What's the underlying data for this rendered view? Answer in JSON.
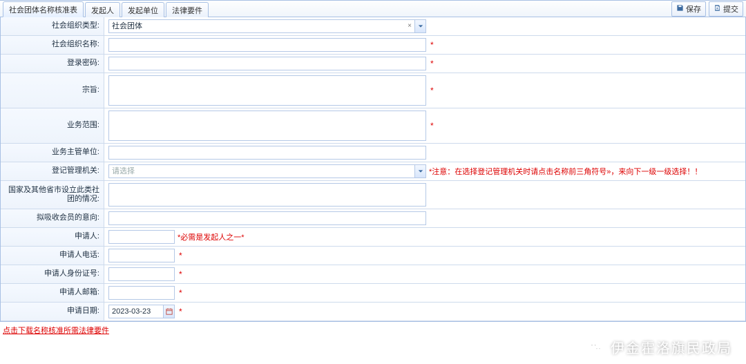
{
  "tabs": [
    {
      "label": "社会团体名称核准表"
    },
    {
      "label": "发起人"
    },
    {
      "label": "发起单位"
    },
    {
      "label": "法律要件"
    }
  ],
  "actions": {
    "save": "保存",
    "submit": "提交"
  },
  "form": {
    "org_type": {
      "label": "社会组织类型:",
      "value": "社会团体"
    },
    "org_name": {
      "label": "社会组织名称:",
      "value": ""
    },
    "login_pwd": {
      "label": "登录密码:",
      "value": ""
    },
    "purpose": {
      "label": "宗旨:",
      "value": ""
    },
    "scope": {
      "label": "业务范围:",
      "value": ""
    },
    "supervisor": {
      "label": "业务主管单位:",
      "value": ""
    },
    "reg_authority": {
      "label": "登记管理机关:",
      "placeholder": "请选择",
      "hint": "*注意：在选择登记管理机关时请点击名称前三角符号»，来向下一级一级选择！！"
    },
    "other_cities": {
      "label": "国家及其他省市设立此类社团的情况:",
      "value": ""
    },
    "recruit_intent": {
      "label": "拟吸收会员的意向:",
      "value": ""
    },
    "applicant": {
      "label": "申请人:",
      "value": "",
      "hint": "*必需是发起人之一*"
    },
    "applicant_tel": {
      "label": "申请人电话:",
      "value": ""
    },
    "applicant_id": {
      "label": "申请人身份证号:",
      "value": ""
    },
    "applicant_email": {
      "label": "申请人邮箱:",
      "value": ""
    },
    "apply_date": {
      "label": "申请日期:",
      "value": "2023-03-23"
    }
  },
  "download_link": "点击下载名称核准所需法律要件",
  "watermark": "伊金霍洛旗民政局"
}
